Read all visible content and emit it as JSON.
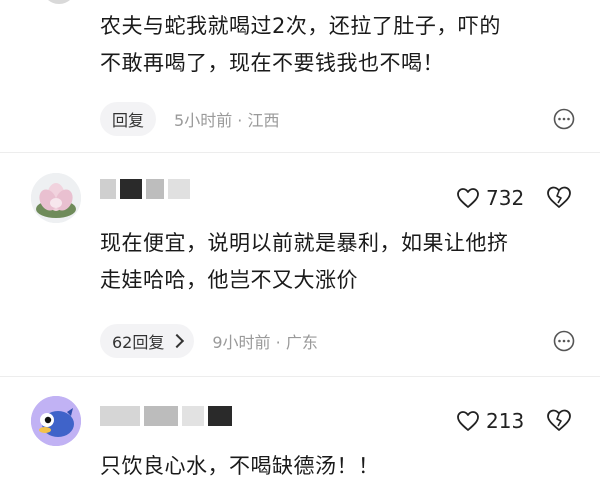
{
  "comment1": {
    "text_line1": "农夫与蛇我就喝过2次，还拉了肚子，吓的",
    "text_line2": "不敢再喝了，现在不要钱我也不喝！",
    "reply_label": "回复",
    "meta": "5小时前 · 江西"
  },
  "comment2": {
    "like_count": "732",
    "text_line1": "现在便宜，说明以前就是暴利，如果让他挤",
    "text_line2": "走娃哈哈，他岂不又大涨价",
    "reply_label": "62回复",
    "meta": "9小时前 · 广东"
  },
  "comment3": {
    "like_count": "213",
    "text_line1": "只饮良心水，不喝缺德汤！！"
  },
  "icons": [
    "more-icon",
    "heart-icon",
    "broken-heart-icon",
    "chevron-right-icon"
  ]
}
